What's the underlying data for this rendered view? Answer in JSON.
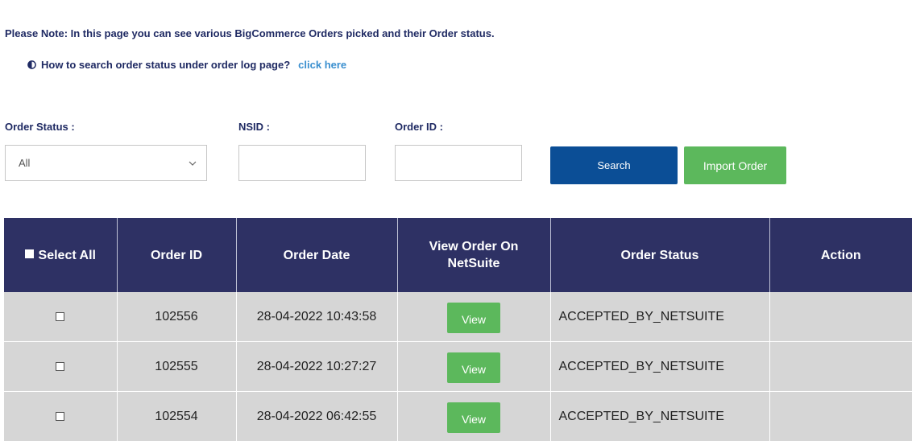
{
  "notice": {
    "text": "Please Note: In this page you can see various BigCommerce Orders picked and their Order status.",
    "howto_text": "How to search order status under order log page?",
    "howto_link": "click here"
  },
  "filters": {
    "status_label": "Order Status :",
    "status_value": "All",
    "nsid_label": "NSID :",
    "nsid_value": "",
    "orderid_label": "Order ID :",
    "orderid_value": "",
    "search_label": "Search",
    "import_label": "Import Order"
  },
  "table": {
    "headers": {
      "select_all": "Select All",
      "order_id": "Order ID",
      "order_date": "Order Date",
      "view_order": "View Order On NetSuite",
      "order_status": "Order Status",
      "action": "Action"
    },
    "rows": [
      {
        "order_id": "102556",
        "order_date": "28-04-2022 10:43:58",
        "view": "View",
        "status": "ACCEPTED_BY_NETSUITE",
        "action": ""
      },
      {
        "order_id": "102555",
        "order_date": "28-04-2022 10:27:27",
        "view": "View",
        "status": "ACCEPTED_BY_NETSUITE",
        "action": ""
      },
      {
        "order_id": "102554",
        "order_date": "28-04-2022 06:42:55",
        "view": "View",
        "status": "ACCEPTED_BY_NETSUITE",
        "action": ""
      }
    ]
  },
  "colors": {
    "header_bg": "#2e3164",
    "row_bg": "#d6d6d6",
    "primary_button": "#0b4e96",
    "success_button": "#5cb85c",
    "link": "#3a8fcf",
    "label_text": "#1f2a63"
  }
}
